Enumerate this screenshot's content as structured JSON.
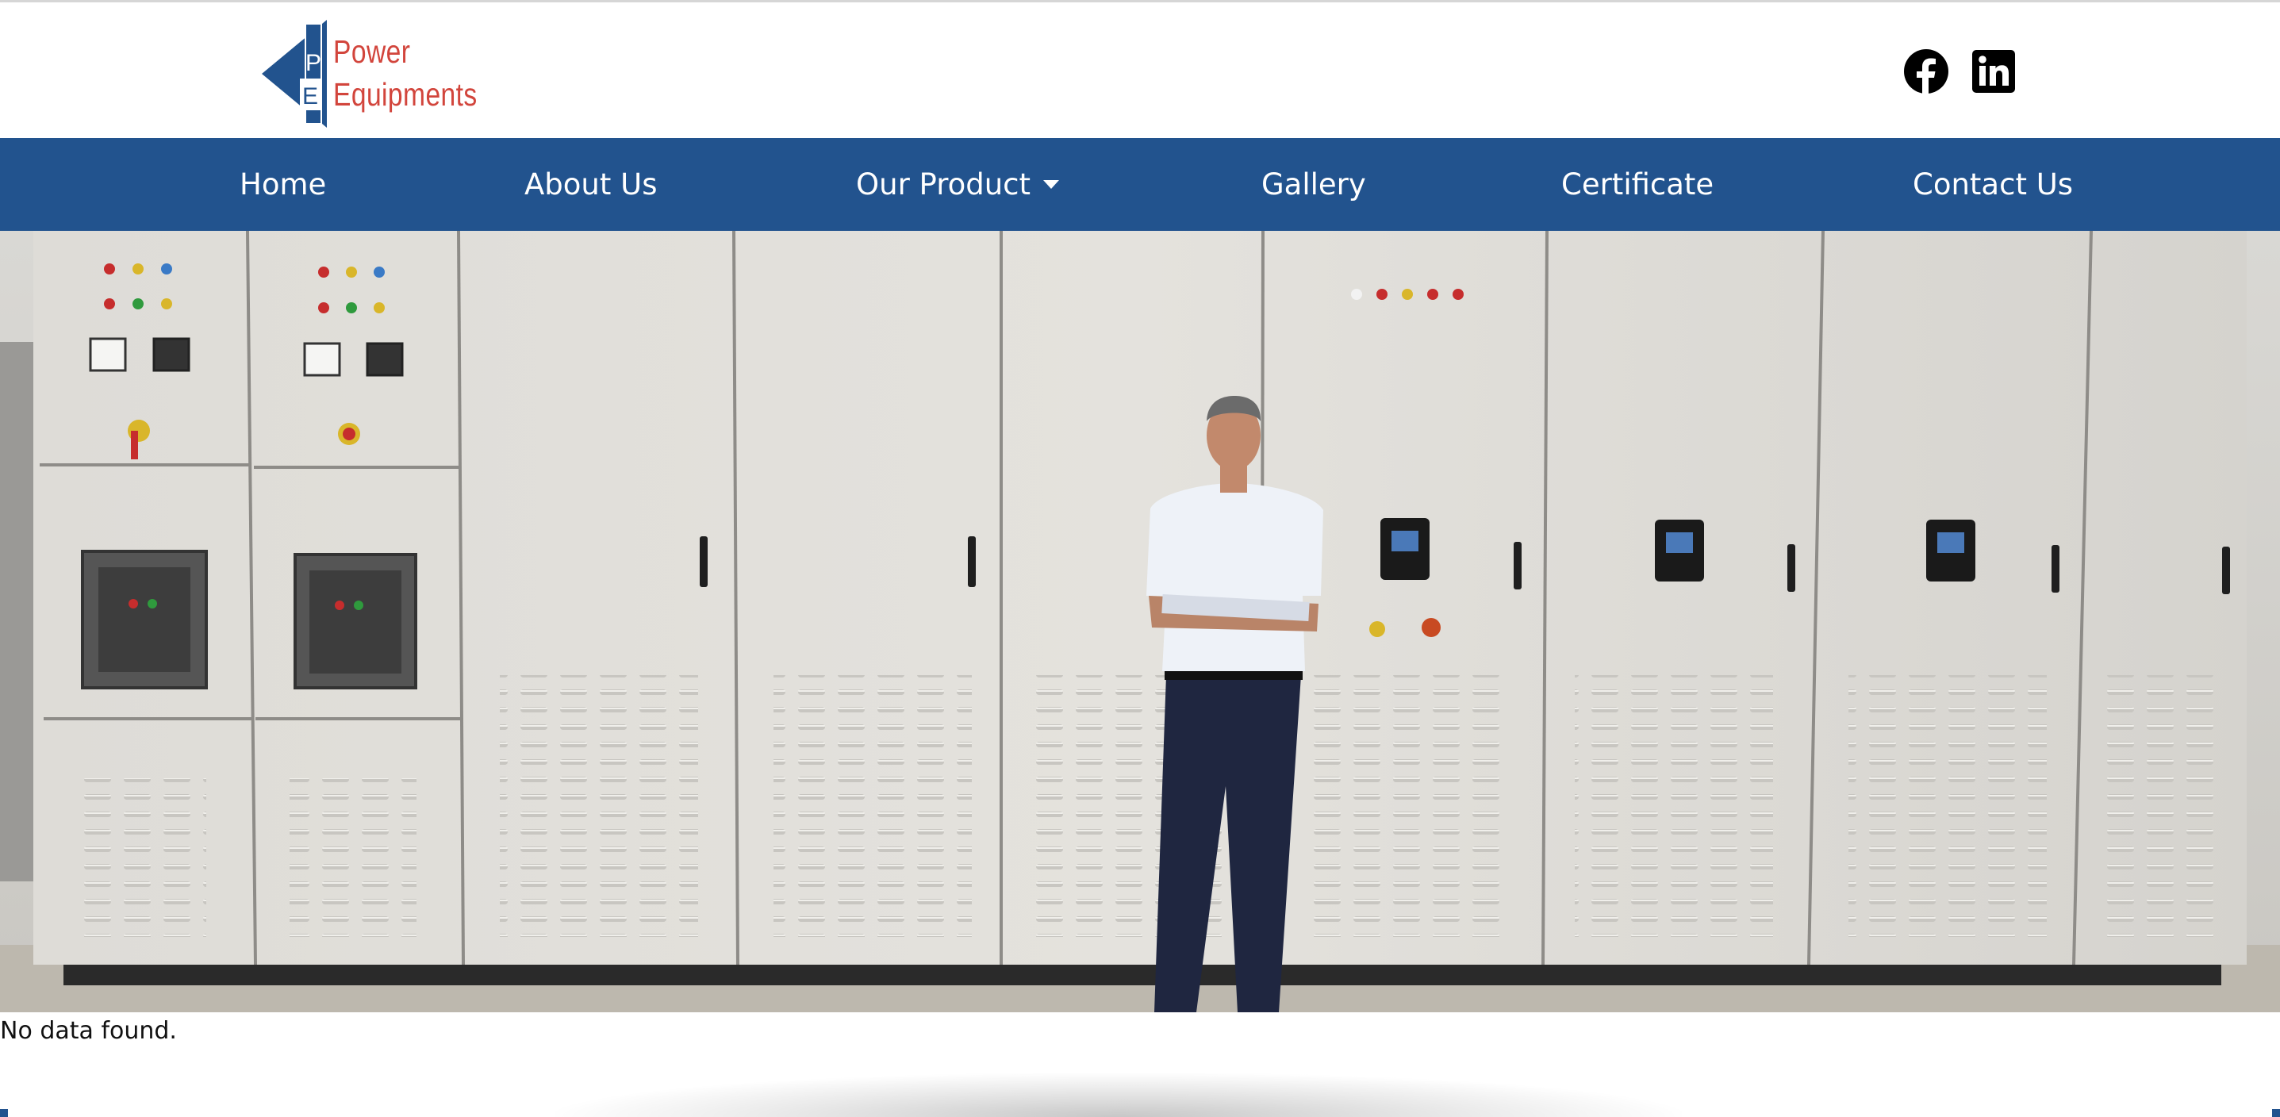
{
  "header": {
    "logo": {
      "line1": "Power",
      "line2": "Equipments",
      "monogram_top": "P",
      "monogram_bottom": "E",
      "colors": {
        "diamond": "#22538e",
        "text": "#d2453c"
      }
    },
    "social": [
      {
        "name": "facebook-icon"
      },
      {
        "name": "linkedin-icon"
      }
    ]
  },
  "nav": {
    "background": "#22538e",
    "items": [
      {
        "label": "Home"
      },
      {
        "label": "About Us"
      },
      {
        "label": "Our Product",
        "has_dropdown": true
      },
      {
        "label": "Gallery"
      },
      {
        "label": "Certificate"
      },
      {
        "label": "Contact Us"
      }
    ]
  },
  "hero": {
    "image": "man standing in front of electrical control panels"
  },
  "main": {
    "empty_message": "No data found."
  }
}
